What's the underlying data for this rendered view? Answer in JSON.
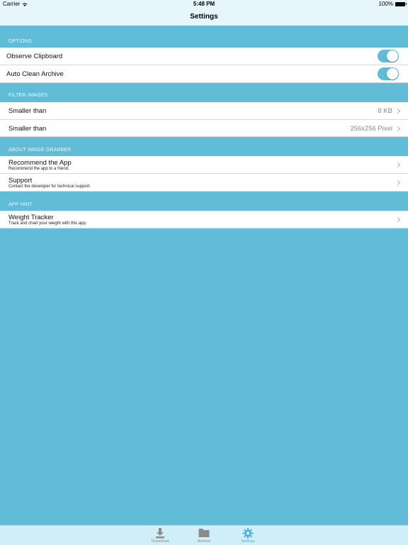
{
  "status_bar": {
    "carrier": "Carrier",
    "time": "5:48 PM",
    "battery": "100%"
  },
  "nav": {
    "title": "Settings"
  },
  "sections": {
    "options": {
      "header": "OPTIONS",
      "items": [
        {
          "label": "Observe Clipboard",
          "toggle": true
        },
        {
          "label": "Auto Clean Archive",
          "toggle": true
        }
      ]
    },
    "filter": {
      "header": "FILTER IMAGES",
      "items": [
        {
          "label": "Smaller than",
          "value": "8 KB"
        },
        {
          "label": "Smaller than",
          "value": "256x256 Pixel"
        }
      ]
    },
    "about": {
      "header": "ABOUT IMAGE GRABBER",
      "items": [
        {
          "label": "Recommend the App",
          "subtitle": "Recommend the app to a friend."
        },
        {
          "label": "Support",
          "subtitle": "Contact the developer for technical support."
        }
      ]
    },
    "hint": {
      "header": "APP HINT",
      "items": [
        {
          "label": "Weight Tracker",
          "subtitle": "Track and chart your weight with this app."
        }
      ]
    }
  },
  "tabs": [
    {
      "label": "Download",
      "icon": "download-icon"
    },
    {
      "label": "Archive",
      "icon": "folder-icon"
    },
    {
      "label": "Settings",
      "icon": "gear-icon",
      "active": true
    }
  ],
  "colors": {
    "accent": "#61bcd8",
    "bar": "#e6f6fb",
    "tab_bar": "#cfeef7"
  }
}
